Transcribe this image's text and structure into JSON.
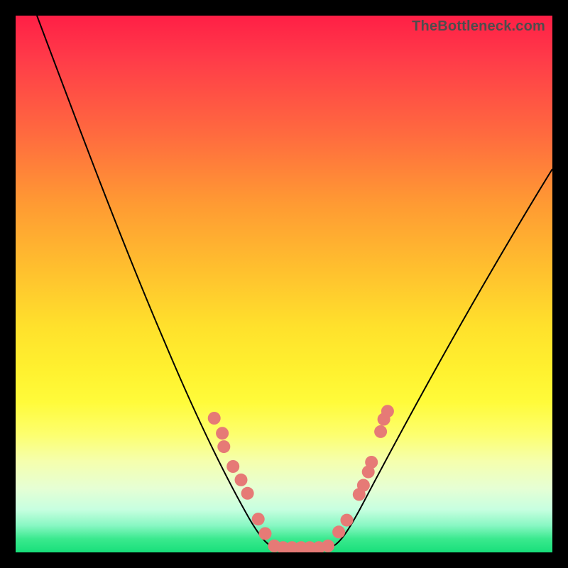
{
  "watermark": {
    "text": "TheBottleneck.com"
  },
  "chart_data": {
    "type": "line",
    "title": "",
    "xlabel": "",
    "ylabel": "",
    "x_range_relative": [
      0,
      1
    ],
    "y_range_bottleneck_pct": [
      0,
      100
    ],
    "series": [
      {
        "name": "bottleneck-curve",
        "note": "V-shaped curve; x is relative compatibility position, y is approximate bottleneck percentage (0 = no bottleneck at bottom).",
        "x": [
          0.04,
          0.09,
          0.14,
          0.19,
          0.24,
          0.28,
          0.31,
          0.34,
          0.37,
          0.4,
          0.43,
          0.45,
          0.475,
          0.5,
          0.53,
          0.56,
          0.585,
          0.61,
          0.65,
          0.7,
          0.76,
          0.83,
          0.9,
          0.97,
          1.0
        ],
        "y": [
          100,
          84,
          68,
          52,
          38,
          27,
          20,
          15,
          11,
          8,
          5,
          2.5,
          0.8,
          0,
          0,
          0,
          1.0,
          3,
          8,
          17,
          28,
          40,
          52,
          62,
          66
        ]
      }
    ],
    "flat_bottom_relative_x": [
      0.475,
      0.585
    ],
    "markers": {
      "note": "Salmon circular markers near the trough on both arms and along the flat bottom.",
      "color": "#e67a76",
      "radius_px": 9,
      "points_relative": [
        {
          "x": 0.37,
          "y": 0.25
        },
        {
          "x": 0.385,
          "y": 0.222
        },
        {
          "x": 0.388,
          "y": 0.197
        },
        {
          "x": 0.405,
          "y": 0.16
        },
        {
          "x": 0.42,
          "y": 0.135
        },
        {
          "x": 0.432,
          "y": 0.11
        },
        {
          "x": 0.452,
          "y": 0.062
        },
        {
          "x": 0.465,
          "y": 0.035
        },
        {
          "x": 0.482,
          "y": 0.012
        },
        {
          "x": 0.498,
          "y": 0.009
        },
        {
          "x": 0.515,
          "y": 0.009
        },
        {
          "x": 0.532,
          "y": 0.009
        },
        {
          "x": 0.548,
          "y": 0.009
        },
        {
          "x": 0.565,
          "y": 0.009
        },
        {
          "x": 0.582,
          "y": 0.012
        },
        {
          "x": 0.602,
          "y": 0.038
        },
        {
          "x": 0.617,
          "y": 0.06
        },
        {
          "x": 0.64,
          "y": 0.108
        },
        {
          "x": 0.648,
          "y": 0.125
        },
        {
          "x": 0.657,
          "y": 0.15
        },
        {
          "x": 0.663,
          "y": 0.168
        },
        {
          "x": 0.68,
          "y": 0.225
        },
        {
          "x": 0.686,
          "y": 0.248
        },
        {
          "x": 0.693,
          "y": 0.263
        }
      ]
    }
  }
}
